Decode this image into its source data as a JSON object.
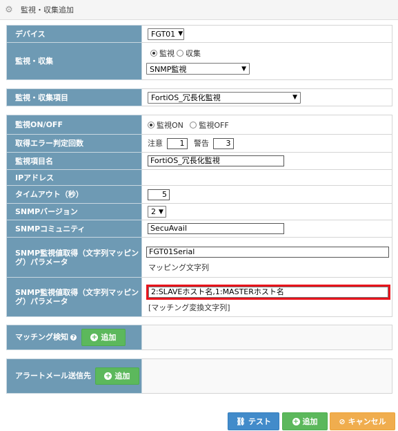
{
  "header": {
    "title": "監視・収集追加",
    "icon": "gear-icon"
  },
  "device": {
    "label": "デバイス",
    "value": "FGT01"
  },
  "monitor_collect": {
    "label": "監視・収集",
    "radio_monitor": "監視",
    "radio_collect": "収集",
    "selected": "監視",
    "type_value": "SNMP監視"
  },
  "item": {
    "label": "監視・収集項目",
    "value": "FortiOS_冗長化監視"
  },
  "onoff": {
    "label": "監視ON/OFF",
    "on": "監視ON",
    "off": "監視OFF",
    "selected": "監視ON"
  },
  "error_count": {
    "label": "取得エラー判定回数",
    "warn_label": "注意",
    "warn_value": "1",
    "alert_label": "警告",
    "alert_value": "3"
  },
  "item_name": {
    "label": "監視項目名",
    "value": "FortiOS_冗長化監視"
  },
  "ip": {
    "label": "IPアドレス",
    "value": ""
  },
  "timeout": {
    "label": "タイムアウト（秒）",
    "value": "5"
  },
  "snmp_version": {
    "label": "SNMPバージョン",
    "value": "2"
  },
  "community": {
    "label": "SNMPコミュニティ",
    "value": "SecuAvail"
  },
  "mapping1": {
    "label": "SNMP監視値取得（文字列マッピング）パラメータ",
    "value": "FGT01Serial",
    "hint": "マッピング文字列"
  },
  "mapping2": {
    "label": "SNMP監視値取得（文字列マッピング）パラメータ",
    "value": "2:SLAVEホスト名,1:MASTERホスト名",
    "hint": "[マッチング変換文字列]"
  },
  "matching": {
    "label": "マッチング検知",
    "add_label": "追加"
  },
  "alert_mail": {
    "label": "アラートメール送信先",
    "add_label": "追加"
  },
  "footer": {
    "test_label": "テスト",
    "add_label": "追加",
    "cancel_label": "キャンセル"
  },
  "colors": {
    "label_bg": "#6e9ab4",
    "green": "#5cb85c",
    "blue": "#428bca",
    "orange": "#f0ad4e",
    "highlight": "#e8141c"
  }
}
